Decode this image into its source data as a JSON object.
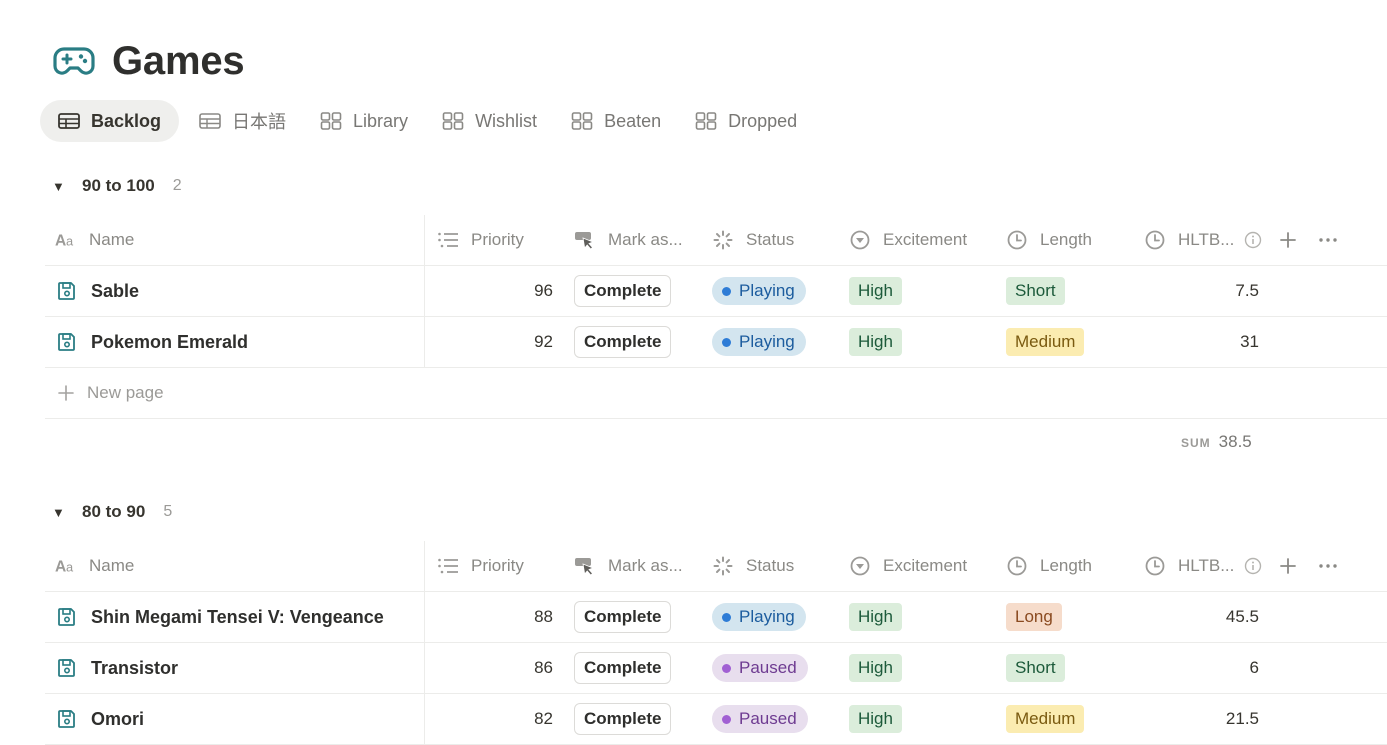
{
  "page": {
    "title": "Games",
    "icon": "gamepad-icon"
  },
  "tabs": [
    {
      "label": "Backlog",
      "icon": "table-icon",
      "active": true
    },
    {
      "label": "日本語",
      "icon": "table-icon",
      "active": false
    },
    {
      "label": "Library",
      "icon": "gallery-icon",
      "active": false
    },
    {
      "label": "Wishlist",
      "icon": "gallery-icon",
      "active": false
    },
    {
      "label": "Beaten",
      "icon": "gallery-icon",
      "active": false
    },
    {
      "label": "Dropped",
      "icon": "gallery-icon",
      "active": false
    }
  ],
  "columns": {
    "name": "Name",
    "priority": "Priority",
    "mark": "Mark as...",
    "status": "Status",
    "excitement": "Excitement",
    "length": "Length",
    "hltb": "HLTB..."
  },
  "colors": {
    "playing_bg": "#d3e5ef",
    "playing_dot": "#2e7cd6",
    "playing_text": "#1c5c9e",
    "paused_bg": "#e8deee",
    "paused_dot": "#a160d3",
    "paused_text": "#6e3b91",
    "high_bg": "#dbeddb",
    "high_text": "#1c5a3a",
    "short_bg": "#dbeddb",
    "short_text": "#1c5a3a",
    "medium_bg": "#fbecb1",
    "medium_text": "#7a5a10",
    "long_bg": "#f6dccb",
    "long_text": "#8a4a20",
    "teal_icon": "#2a7d84"
  },
  "groups": [
    {
      "name": "90 to 100",
      "count": "2",
      "rows": [
        {
          "name": "Sable",
          "priority": "96",
          "mark": "Complete",
          "status": "Playing",
          "excitement": "High",
          "length": "Short",
          "hltb": "7.5"
        },
        {
          "name": "Pokemon Emerald",
          "priority": "92",
          "mark": "Complete",
          "status": "Playing",
          "excitement": "High",
          "length": "Medium",
          "hltb": "31"
        }
      ],
      "new_page": "New page",
      "sum_label": "SUM",
      "sum_value": "38.5"
    },
    {
      "name": "80 to 90",
      "count": "5",
      "rows": [
        {
          "name": "Shin Megami Tensei V: Vengeance",
          "priority": "88",
          "mark": "Complete",
          "status": "Playing",
          "excitement": "High",
          "length": "Long",
          "hltb": "45.5"
        },
        {
          "name": "Transistor",
          "priority": "86",
          "mark": "Complete",
          "status": "Paused",
          "excitement": "High",
          "length": "Short",
          "hltb": "6"
        },
        {
          "name": "Omori",
          "priority": "82",
          "mark": "Complete",
          "status": "Paused",
          "excitement": "High",
          "length": "Medium",
          "hltb": "21.5"
        }
      ]
    }
  ]
}
